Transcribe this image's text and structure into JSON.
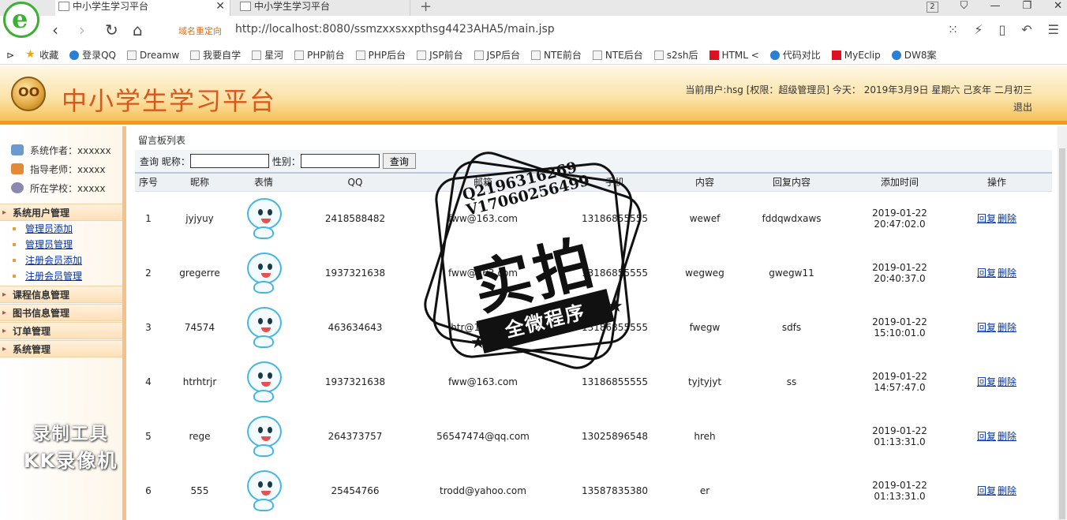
{
  "browser": {
    "tabs": [
      {
        "label": "中小学生学习平台"
      },
      {
        "label": "中小学生学习平台"
      }
    ],
    "tab_count_badge": "2",
    "redirect_label": "域名重定向",
    "url": "http://localhost:8080/ssmzxxsxxpthsg4423AHA5/main.jsp",
    "bookmarks": [
      "收藏",
      "登录QQ",
      "Dreamw",
      "我要自学",
      "星河",
      "PHP前台",
      "PHP后台",
      "JSP前台",
      "JSP后台",
      "NTE前台",
      "NTE后台",
      "s2sh后",
      "HTML <",
      "代码对比",
      "MyEclip",
      "DW8案"
    ]
  },
  "header": {
    "logo_text": "OO",
    "title": "中小学生学习平台",
    "user_info": "当前用户:hsg [权限：超级管理员] 今天： 2019年3月9日 星期六 己亥年 二月初三",
    "logout": "退出"
  },
  "sidebar": {
    "info": [
      {
        "label": "系统作者：xxxxxx"
      },
      {
        "label": "指导老师：xxxxx"
      },
      {
        "label": "所在学校：xxxxx"
      }
    ],
    "groups": [
      {
        "label": "系统用户管理",
        "items": [
          "管理员添加",
          "管理员管理",
          "注册会员添加",
          "注册会员管理"
        ]
      },
      {
        "label": "课程信息管理",
        "items": []
      },
      {
        "label": "图书信息管理",
        "items": []
      },
      {
        "label": "订单管理",
        "items": []
      },
      {
        "label": "系统管理",
        "items": []
      }
    ],
    "watermark_line1": "录制工具",
    "watermark_line2": "KK录像机"
  },
  "main": {
    "breadcrumb": "留言板列表",
    "search": {
      "label_query": "查询",
      "label_nick": "昵称：",
      "nick_value": "",
      "label_gender": "性别：",
      "gender_value": "",
      "button": "查询"
    },
    "columns": [
      "序号",
      "昵称",
      "表情",
      "QQ",
      "邮箱",
      "手机",
      "内容",
      "回复内容",
      "添加时间",
      "操作"
    ],
    "rows": [
      {
        "no": "1",
        "nick": "jyjyuy",
        "qq": "2418588482",
        "email": "fww@163.com",
        "phone": "13186855555",
        "content": "wewef",
        "reply": "fddqwdxaws",
        "time": "2019-01-22 20:47:02.0"
      },
      {
        "no": "2",
        "nick": "gregerre",
        "qq": "1937321638",
        "email": "fww@163.com",
        "phone": "13186855555",
        "content": "wegweg",
        "reply": "gwegw11",
        "time": "2019-01-22 20:40:37.0"
      },
      {
        "no": "3",
        "nick": "74574",
        "qq": "463634643",
        "email": "htr@163.com",
        "phone": "13186855555",
        "content": "fwegw",
        "reply": "sdfs",
        "time": "2019-01-22 15:10:01.0"
      },
      {
        "no": "4",
        "nick": "htrhtrjr",
        "qq": "1937321638",
        "email": "fww@163.com",
        "phone": "13186855555",
        "content": "tyjtyjyt",
        "reply": "ss",
        "time": "2019-01-22 14:57:47.0"
      },
      {
        "no": "5",
        "nick": "rege",
        "qq": "264373757",
        "email": "56547474@qq.com",
        "phone": "13025896548",
        "content": "hreh",
        "reply": "",
        "time": "2019-01-22 01:13:31.0"
      },
      {
        "no": "6",
        "nick": "555",
        "qq": "25454766",
        "email": "trodd@yahoo.com",
        "phone": "13587835380",
        "content": "er",
        "reply": "",
        "time": "2019-01-22 01:13:31.0"
      }
    ],
    "op_reply": "回复",
    "op_delete": "删除"
  },
  "stamp": {
    "line1": "Q2196316269",
    "line2": "V17060256499",
    "big": "实拍",
    "ribbon": "全微程序"
  }
}
